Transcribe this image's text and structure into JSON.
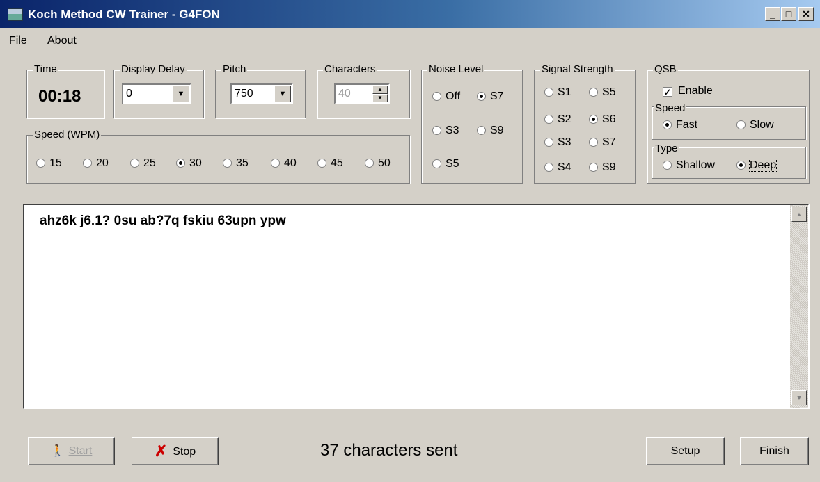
{
  "window": {
    "title": "Koch Method CW Trainer - G4FON"
  },
  "menu": {
    "items": [
      "File",
      "About"
    ]
  },
  "time": {
    "label": "Time",
    "value": "00:18"
  },
  "display_delay": {
    "label": "Display Delay",
    "value": "0"
  },
  "pitch": {
    "label": "Pitch",
    "value": "750"
  },
  "characters": {
    "label": "Characters",
    "value": "40"
  },
  "speed": {
    "label": "Speed (WPM)",
    "options": [
      "15",
      "20",
      "25",
      "30",
      "35",
      "40",
      "45",
      "50"
    ],
    "selected": "30"
  },
  "noise": {
    "label": "Noise Level",
    "options": [
      "Off",
      "S7",
      "S3",
      "S9",
      "S5"
    ],
    "selected": "S7"
  },
  "signal": {
    "label": "Signal Strength",
    "options": [
      "S1",
      "S5",
      "S2",
      "S6",
      "S3",
      "S7",
      "S4",
      "S9"
    ],
    "selected": "S6"
  },
  "qsb": {
    "label": "QSB",
    "enable_label": "Enable",
    "enabled": true,
    "speed": {
      "label": "Speed",
      "options": [
        "Fast",
        "Slow"
      ],
      "selected": "Fast"
    },
    "type": {
      "label": "Type",
      "options": [
        "Shallow",
        "Deep"
      ],
      "selected": "Deep"
    }
  },
  "output": {
    "text": "ahz6k j6.1? 0su ab?7q fskiu 63upn ypw"
  },
  "buttons": {
    "start": "Start",
    "stop": "Stop",
    "setup": "Setup",
    "finish": "Finish"
  },
  "status": "37 characters sent",
  "colors": {
    "title_bar_start": "#0a246a",
    "window_bg": "#d4d0c8",
    "stop_icon": "#cc0000"
  }
}
